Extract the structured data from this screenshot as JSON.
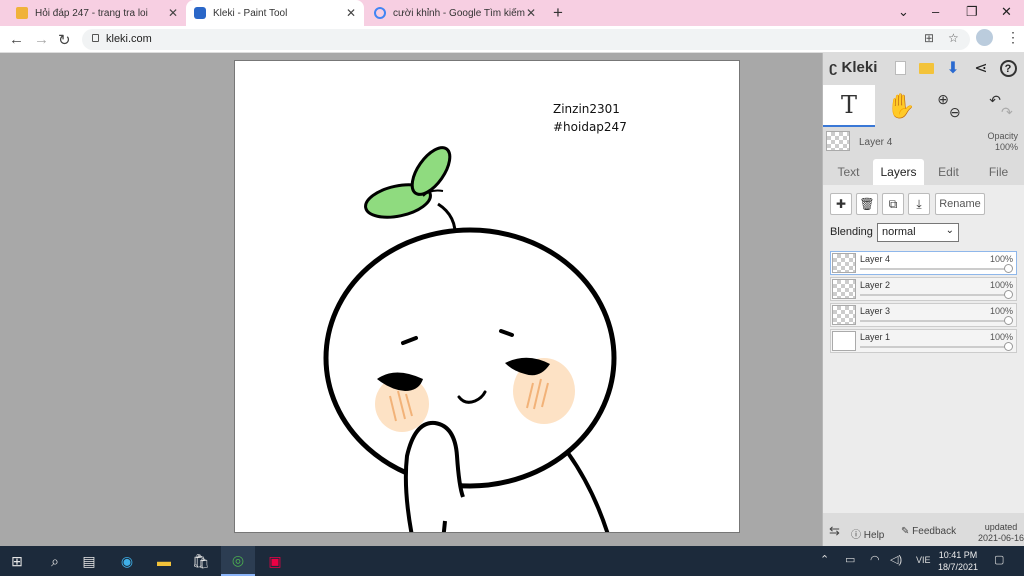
{
  "browser": {
    "tabs": [
      {
        "title": "Hỏi đáp 247 - trang tra loi",
        "favicon": "hoidap-favicon",
        "active": false
      },
      {
        "title": "Kleki - Paint Tool",
        "favicon": "kleki-favicon",
        "active": true
      },
      {
        "title": "cười khỉnh - Google Tìm kiếm",
        "favicon": "google-favicon",
        "active": false
      }
    ],
    "new_tab": "+",
    "url": "kleki.com",
    "window_buttons": {
      "minimize": "–",
      "restore": "❐",
      "close": "✕"
    }
  },
  "canvas": {
    "signature_line1": "Zinzin2301",
    "signature_line2": "#hoidap247",
    "colors": {
      "sprout": "#8fdb7f",
      "cheek": "#fde2c5",
      "line": "#000000"
    }
  },
  "panel": {
    "logo": "Kleki",
    "current_layer": {
      "name": "Layer 4",
      "opacity_label": "Opacity",
      "opacity_value": "100%"
    },
    "tabs": [
      {
        "label": "Text"
      },
      {
        "label": "Layers"
      },
      {
        "label": "Edit"
      },
      {
        "label": "File"
      }
    ],
    "rename_label": "Rename",
    "blending_label": "Blending",
    "blending_value": "normal",
    "layers": [
      {
        "name": "Layer 4",
        "opacity": "100%",
        "selected": true
      },
      {
        "name": "Layer 2",
        "opacity": "100%",
        "selected": false
      },
      {
        "name": "Layer 3",
        "opacity": "100%",
        "selected": false
      },
      {
        "name": "Layer 1",
        "opacity": "100%",
        "selected": false
      }
    ],
    "footer": {
      "help": "Help",
      "feedback": "Feedback",
      "updated": "updated",
      "updated_date": "2021-06-16"
    }
  },
  "taskbar": {
    "lang": "VIE",
    "time": "10:41 PM",
    "date": "18/7/2021"
  }
}
